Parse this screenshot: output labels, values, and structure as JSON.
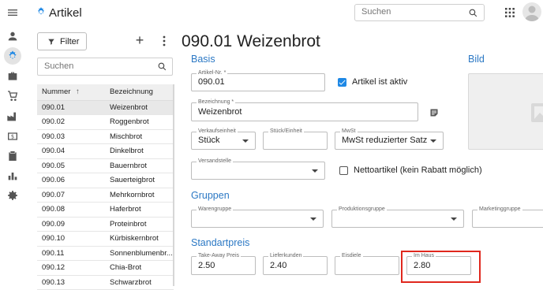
{
  "app": {
    "title": "Artikel"
  },
  "search": {
    "placeholder": "Suchen"
  },
  "rail": {
    "items": [
      {
        "icon": "menu-icon"
      },
      {
        "icon": "person-icon"
      },
      {
        "icon": "article-icon"
      },
      {
        "icon": "briefcase-icon"
      },
      {
        "icon": "cart-icon"
      },
      {
        "icon": "factory-icon"
      },
      {
        "icon": "money-icon"
      },
      {
        "icon": "clipboard-icon"
      },
      {
        "icon": "bar-chart-icon"
      },
      {
        "icon": "settings-icon"
      }
    ]
  },
  "list": {
    "filter_label": "Filter",
    "search_placeholder": "Suchen",
    "columns": [
      "Nummer",
      "Bezeichnung"
    ],
    "sort_indicator": "↑",
    "rows": [
      {
        "nummer": "090.01",
        "bezeichnung": "Weizenbrot",
        "selected": true
      },
      {
        "nummer": "090.02",
        "bezeichnung": "Roggenbrot"
      },
      {
        "nummer": "090.03",
        "bezeichnung": "Mischbrot"
      },
      {
        "nummer": "090.04",
        "bezeichnung": "Dinkelbrot"
      },
      {
        "nummer": "090.05",
        "bezeichnung": "Bauernbrot"
      },
      {
        "nummer": "090.06",
        "bezeichnung": "Sauerteigbrot"
      },
      {
        "nummer": "090.07",
        "bezeichnung": "Mehrkornbrot"
      },
      {
        "nummer": "090.08",
        "bezeichnung": "Haferbrot"
      },
      {
        "nummer": "090.09",
        "bezeichnung": "Proteinbrot"
      },
      {
        "nummer": "090.10",
        "bezeichnung": "Kürbiskernbrot"
      },
      {
        "nummer": "090.11",
        "bezeichnung": "Sonnenblumenbr..."
      },
      {
        "nummer": "090.12",
        "bezeichnung": "Chia-Brot"
      },
      {
        "nummer": "090.13",
        "bezeichnung": "Schwarzbrot"
      }
    ]
  },
  "detail": {
    "title": "090.01 Weizenbrot",
    "sections": {
      "basis": "Basis",
      "bild": "Bild",
      "gruppen": "Gruppen",
      "standardpreis": "Standartpreis"
    },
    "fields": {
      "artikel_nr": {
        "label": "Artikel-Nr. *",
        "value": "090.01"
      },
      "artikel_aktiv": {
        "label": "Artikel ist aktiv",
        "checked": true
      },
      "bezeichnung": {
        "label": "Bezeichnung *",
        "value": "Weizenbrot"
      },
      "verkaufseinheit": {
        "label": "Verkaufseinheit",
        "value": "Stück"
      },
      "stueck_einheit": {
        "label": "Stück/Einheit",
        "value": ""
      },
      "mwst": {
        "label": "MwSt",
        "value": "MwSt reduzierter Satz"
      },
      "versandstelle": {
        "label": "Versandstelle",
        "value": ""
      },
      "nettoartikel": {
        "label": "Nettoartikel (kein Rabatt möglich)",
        "checked": false
      },
      "warengruppe": {
        "label": "Warengruppe",
        "value": ""
      },
      "produktionsgruppe": {
        "label": "Produktionsgruppe",
        "value": ""
      },
      "marketinggruppe": {
        "label": "Marketinggruppe",
        "value": ""
      },
      "take_away": {
        "label": "Take-Away Preis",
        "value": "2.50"
      },
      "lieferkunden": {
        "label": "Lieferkunden",
        "value": "2.40"
      },
      "eisdiele": {
        "label": "Eisdiele",
        "value": ""
      },
      "im_haus": {
        "label": "Im Haus",
        "value": "2.80"
      }
    }
  },
  "colors": {
    "accent": "#1e88e5",
    "section_title": "#2b78c4",
    "highlight": "#e0281e"
  }
}
